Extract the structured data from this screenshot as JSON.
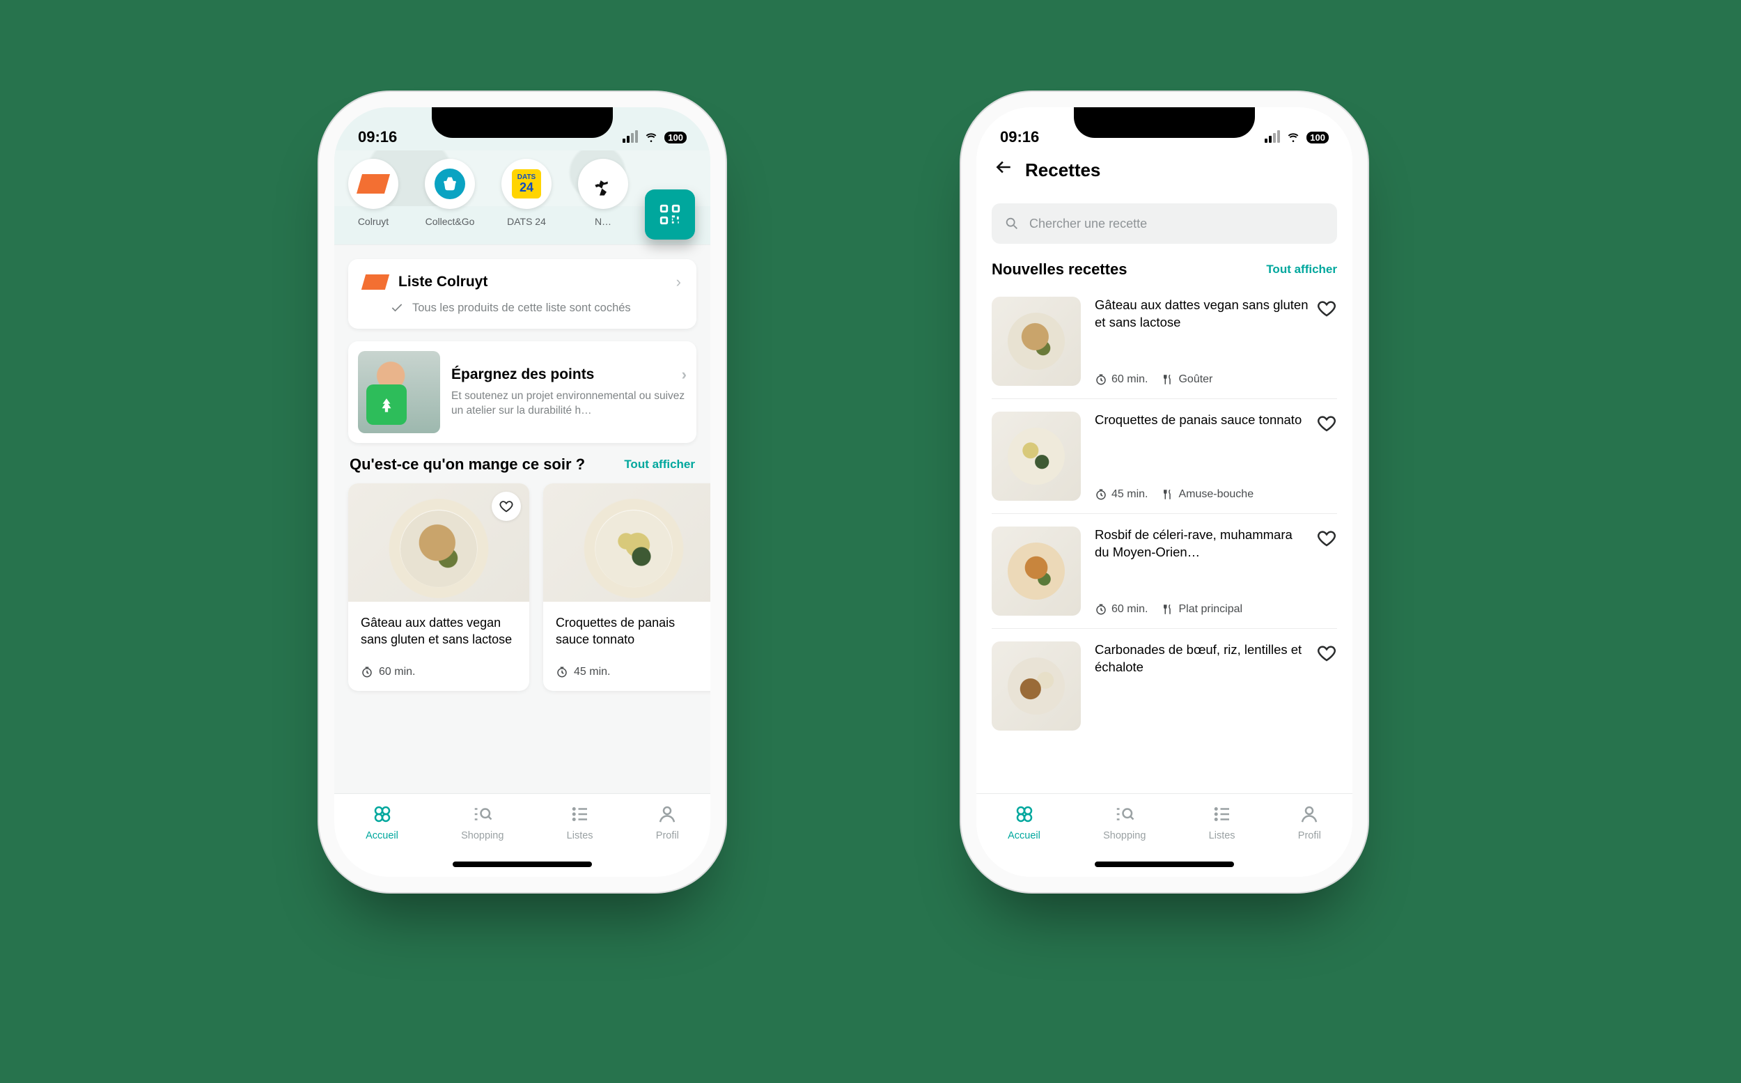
{
  "status": {
    "time": "09:16",
    "battery": "100"
  },
  "accent": "#00a79d",
  "left": {
    "stories": [
      {
        "name": "Colruyt"
      },
      {
        "name": "Collect&Go"
      },
      {
        "name": "DATS 24"
      },
      {
        "name": "N…"
      }
    ],
    "qr_label": "qr-code",
    "list_card": {
      "title": "Liste Colruyt",
      "subtitle": "Tous les produits de cette liste sont cochés"
    },
    "points_card": {
      "title": "Épargnez des points",
      "subtitle": "Et soutenez un projet environnemental ou suivez un atelier sur la durabilité  h…"
    },
    "section": {
      "title": "Qu'est-ce qu'on mange ce soir ?",
      "all": "Tout afficher",
      "recipes": [
        {
          "title": "Gâteau aux dattes vegan sans gluten et sans lactose",
          "time": "60 min."
        },
        {
          "title": "Croquettes de panais sauce tonnato",
          "time": "45 min."
        }
      ]
    }
  },
  "right": {
    "header": "Recettes",
    "search_placeholder": "Chercher une recette",
    "section_title": "Nouvelles recettes",
    "section_all": "Tout afficher",
    "recipes": [
      {
        "title": "Gâteau aux dattes vegan sans gluten et sans lactose",
        "time": "60 min.",
        "meal": "Goûter"
      },
      {
        "title": "Croquettes de panais sauce tonnato",
        "time": "45 min.",
        "meal": "Amuse-bouche"
      },
      {
        "title": "Rosbif de céleri-rave, muhammara du Moyen-Orien…",
        "time": "60 min.",
        "meal": "Plat principal"
      },
      {
        "title": "Carbonades de bœuf, riz, lentilles et échalote",
        "time": "",
        "meal": ""
      }
    ]
  },
  "tabs": [
    {
      "label": "Accueil"
    },
    {
      "label": "Shopping"
    },
    {
      "label": "Listes"
    },
    {
      "label": "Profil"
    }
  ]
}
